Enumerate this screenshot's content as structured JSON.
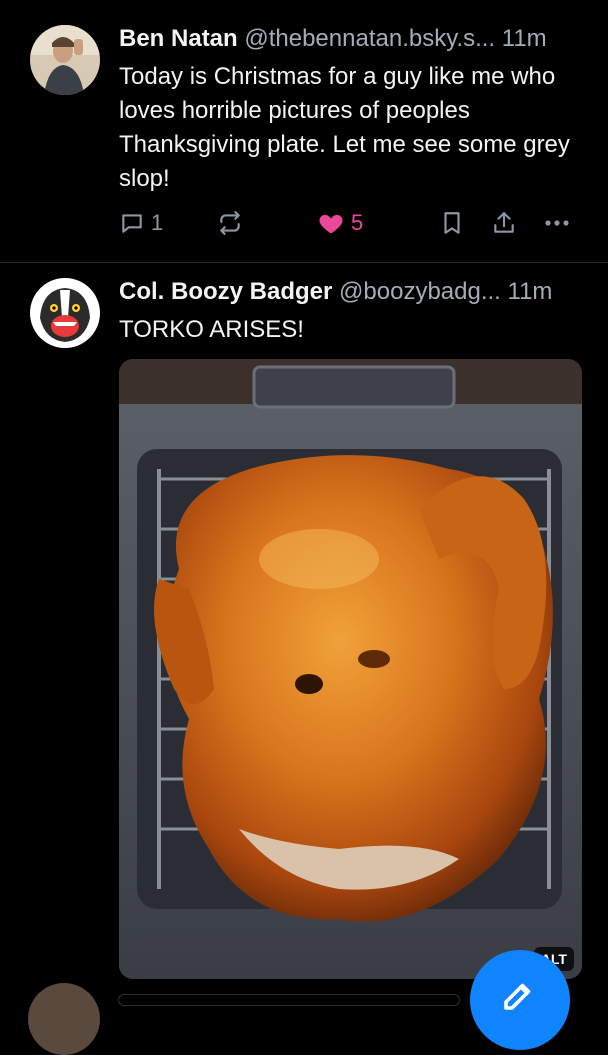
{
  "posts": [
    {
      "author_name": "Ben Natan",
      "author_handle": "@thebennatan.bsky.s...",
      "time": "11m",
      "text": "Today is Christmas for a guy like me who loves horrible pictures of peoples Thanksgiving plate. Let me see some grey slop!",
      "reply_count": "1",
      "like_count": "5",
      "liked": true,
      "icons": [
        "reply-icon",
        "repost-icon",
        "heart-icon",
        "bookmark-icon",
        "share-icon",
        "more-icon"
      ]
    },
    {
      "author_name": "Col. Boozy Badger",
      "author_handle": "@boozybadg...",
      "time": "11m",
      "text": "TORKO ARISES!",
      "image_alt_badge": "ALT"
    }
  ],
  "colors": {
    "background": "#000000",
    "text": "#f1f3f5",
    "muted": "#a3acb8",
    "action": "#8d96a3",
    "like": "#ec4899",
    "accent": "#1083fe"
  }
}
